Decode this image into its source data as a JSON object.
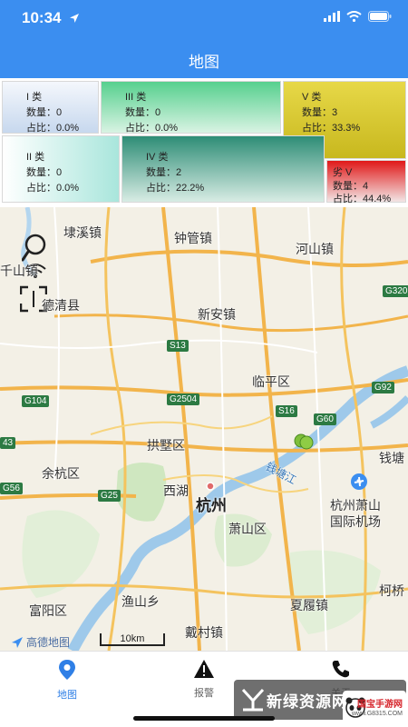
{
  "status_bar": {
    "time": "10:34"
  },
  "nav": {
    "title": "地图"
  },
  "classes": [
    {
      "key": "I",
      "title": "I 类",
      "count": "数量：0",
      "ratio": "占比：0.0%"
    },
    {
      "key": "III",
      "title": "III 类",
      "count": "数量：0",
      "ratio": "占比：0.0%"
    },
    {
      "key": "V",
      "title": "V 类",
      "count": "数量：3",
      "ratio": "占比：33.3%"
    },
    {
      "key": "II",
      "title": "II 类",
      "count": "数量：0",
      "ratio": "占比：0.0%"
    },
    {
      "key": "IV",
      "title": "IV 类",
      "count": "数量：2",
      "ratio": "占比：22.2%"
    },
    {
      "key": "bad",
      "title": "劣 V",
      "count": "数量：4",
      "ratio": "占比：44.4%"
    }
  ],
  "map": {
    "places": [
      "埭溪镇",
      "钟管镇",
      "河山镇",
      "千山镇",
      "德清县",
      "新安镇",
      "临平区",
      "拱墅区",
      "余杭区",
      "西湖",
      "杭州",
      "萧山区",
      "杭州萧山",
      "国际机场",
      "钱塘",
      "富阳区",
      "渔山乡",
      "戴村镇",
      "夏履镇",
      "柯桥"
    ],
    "river_label": "钱塘江",
    "roads": [
      "G320",
      "S13",
      "G104",
      "G2504",
      "G92",
      "S16",
      "G60",
      "G25",
      "G56",
      "43"
    ],
    "provider": "高德地图",
    "scale": "10km",
    "icons": [
      "search-icon",
      "wifi-signal-icon",
      "scan-frame-icon",
      "map-marker-icon",
      "airport-icon"
    ],
    "marker_color": "#7fbf3a"
  },
  "tabs": [
    {
      "label": "地图",
      "icon": "map-pin-icon",
      "active": true
    },
    {
      "label": "报警",
      "icon": "warning-icon",
      "active": false
    },
    {
      "label": "关于",
      "icon": "phone-icon",
      "active": false
    }
  ],
  "watermark": {
    "text": "新绿资源网",
    "badge": "国宝手游网",
    "badge_sub": "www.G8315.COM"
  },
  "colors": {
    "header": "#3b8ef0",
    "active_tab": "#2f7fe6"
  }
}
